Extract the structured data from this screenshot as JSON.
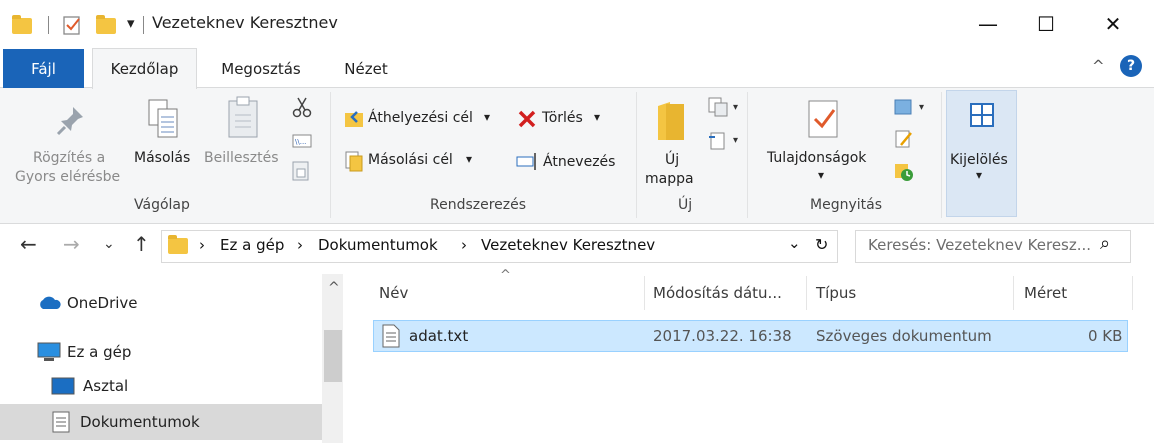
{
  "window": {
    "title": "Vezeteknev Keresztnev",
    "qat_dropdown": "▾",
    "minimize": "—",
    "maximize": "☐",
    "close": "✕"
  },
  "tabs": {
    "file": "Fájl",
    "home": "Kezdőlap",
    "share": "Megosztás",
    "view": "Nézet",
    "collapse": "^",
    "help": "?"
  },
  "ribbon": {
    "clipboard": {
      "label": "Vágólap",
      "pin_line1": "Rögzítés a",
      "pin_line2": "Gyors elérésbe",
      "copy": "Másolás",
      "paste": "Beillesztés"
    },
    "organize": {
      "label": "Rendszerezés",
      "move_to": "Áthelyezési cél",
      "copy_to": "Másolási cél",
      "delete": "Törlés",
      "rename": "Átnevezés",
      "dropdown": "▾"
    },
    "new": {
      "label": "Új",
      "new_folder_line1": "Új",
      "new_folder_line2": "mappa"
    },
    "open": {
      "label": "Megnyitás",
      "properties": "Tulajdonságok",
      "dropdown": "▾"
    },
    "select": {
      "label": "Kijelölés",
      "dropdown": "▾"
    }
  },
  "address": {
    "back": "←",
    "forward": "→",
    "recent": "⌄",
    "up": "↑",
    "sep": "›",
    "crumbs": [
      "Ez a gép",
      "Dokumentumok",
      "Vezeteknev Keresztnev"
    ],
    "dropdown": "⌄",
    "refresh": "↻",
    "search_placeholder": "Keresés: Vezeteknev Keresz...",
    "search_icon": "⌕"
  },
  "nav_pane": {
    "scroll_up": "^",
    "items": [
      {
        "label": "OneDrive",
        "icon": "cloud-icon"
      },
      {
        "label": "Ez a gép",
        "icon": "computer-icon"
      },
      {
        "label": "Asztal",
        "icon": "desktop-icon"
      },
      {
        "label": "Dokumentumok",
        "icon": "documents-icon"
      }
    ]
  },
  "file_list": {
    "sort_indicator": "^",
    "columns": [
      "Név",
      "Módosítás dátu...",
      "Típus",
      "Méret"
    ],
    "rows": [
      {
        "name": "adat.txt",
        "modified": "2017.03.22. 16:38",
        "type": "Szöveges dokumentum",
        "size": "0 KB"
      }
    ]
  },
  "colors": {
    "file_tab": "#1a64b8",
    "ribbon_bg": "#f5f6f7",
    "selection": "#cce8ff",
    "selection_border": "#99d1ff",
    "folder": "#f4c542"
  }
}
